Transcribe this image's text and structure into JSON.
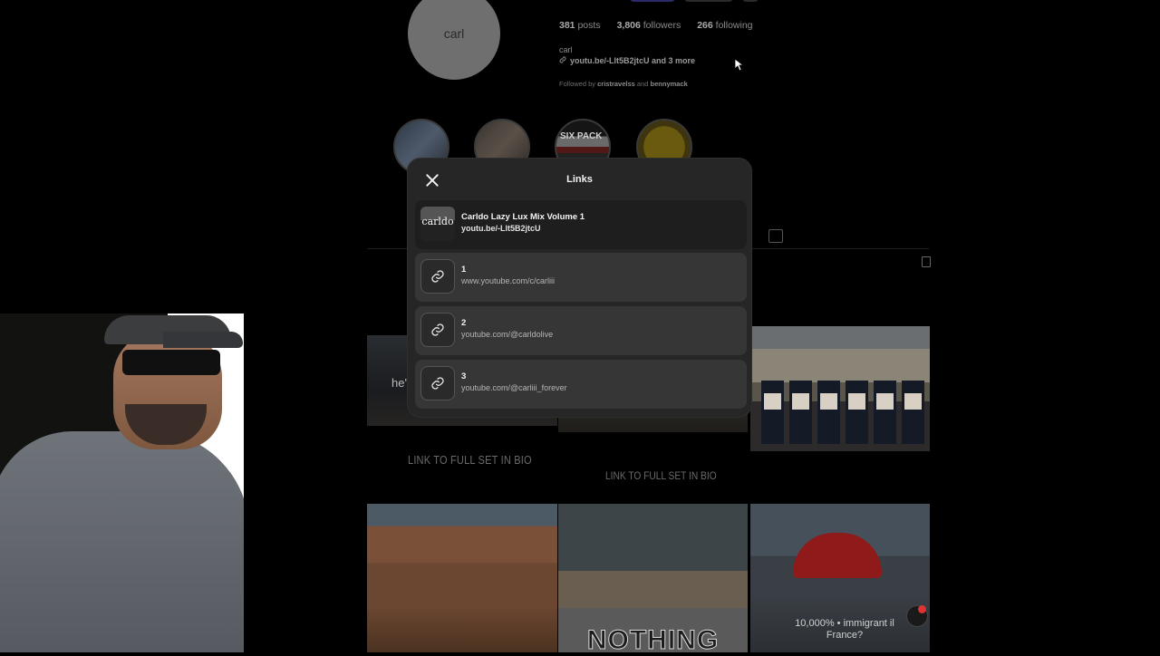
{
  "profile": {
    "avatar_text": "carl",
    "posts_count": "381",
    "posts_label": "posts",
    "followers_count": "3,806",
    "followers_label": "followers",
    "following_count": "266",
    "following_label": "following",
    "name": "carl",
    "bio_link": "youtu.be/-Llt5B2jtcU and 3 more",
    "followed_by_prefix": "Followed by",
    "followed_by_1": "cristravelss",
    "followed_by_and": "and",
    "followed_by_2": "bennymack"
  },
  "highlights": [
    {
      "name": "highlight-1"
    },
    {
      "name": "highlight-2"
    },
    {
      "name": "highlight-3",
      "text": "SIX PACK"
    },
    {
      "name": "highlight-4"
    }
  ],
  "posts": {
    "post_a_text": "he'",
    "post_b_label": "carldo",
    "banner_1": "LINK TO FULL SET IN BIO",
    "banner_2": "LINK TO FULL SET IN BIO",
    "post_e_text": "NOTHING",
    "post_f_text_line1": "10,000% • immigrant il",
    "post_f_text_line2": "France?"
  },
  "modal": {
    "title": "Links",
    "featured": {
      "thumb_text": "carldo",
      "title": "Carldo Lazy Lux Mix Volume 1",
      "url": "youtu.be/-Llt5B2jtcU"
    },
    "links": [
      {
        "title": "1",
        "url": "www.youtube.com/c/carliii"
      },
      {
        "title": "2",
        "url": "youtube.com/@carldolive"
      },
      {
        "title": "3",
        "url": "youtube.com/@carliii_forever"
      }
    ]
  },
  "colors": {
    "modal_bg": "#262626",
    "link_row_bg": "#363636",
    "featured_row_bg": "#1e1e1e",
    "page_bg": "#000000"
  },
  "icons": [
    "close-icon",
    "link-icon",
    "tagged-icon",
    "message-icon"
  ]
}
